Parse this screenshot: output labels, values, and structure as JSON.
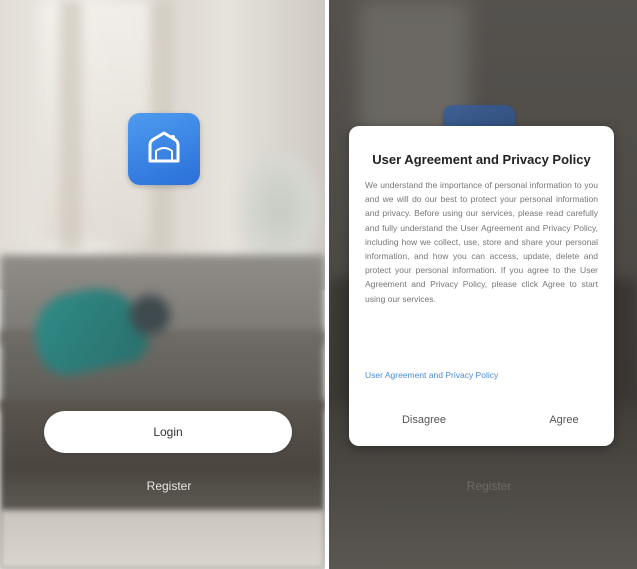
{
  "app": {
    "icon_name": "smart-home-icon",
    "accent_color": "#3d86e6"
  },
  "login_screen": {
    "login_button_label": "Login",
    "register_link_label": "Register"
  },
  "agreement_dialog": {
    "title": "User Agreement and Privacy Policy",
    "body": "We understand the importance of personal information to you and we will do our best to protect your personal information and privacy. Before using our services, please read carefully and fully understand the User Agreement and Privacy Policy, including how we collect, use, store and share your personal information, and how you can access, update, delete and protect your personal information. If you agree to the User Agreement and Privacy Policy, please click Agree to start using our services.",
    "link_text": "User Agreement and Privacy Policy",
    "disagree_label": "Disagree",
    "agree_label": "Agree"
  },
  "background": {
    "register_label": "Register"
  }
}
